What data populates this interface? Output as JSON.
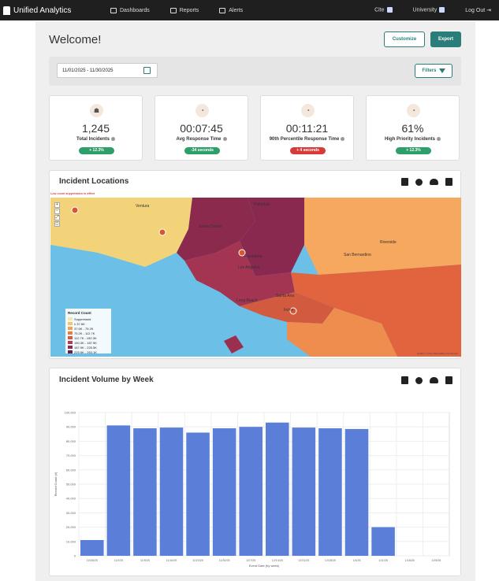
{
  "header": {
    "brand": "Unified Analytics",
    "nav": [
      "Dashboards",
      "Reports",
      "Alerts"
    ],
    "right": [
      "Cite",
      "University",
      "Log Out"
    ]
  },
  "page": {
    "title": "Welcome!",
    "customize_label": "Customize",
    "export_label": "Export",
    "date_range": "11/01/2025 - 11/30/2025",
    "filters_label": "Filters"
  },
  "kpis": [
    {
      "icon": "incidents-icon",
      "value": "1,245",
      "label": "Total Incidents",
      "badge": "+ 12.3%",
      "badge_color": "#2e9e6a"
    },
    {
      "icon": "stopwatch-icon",
      "value": "00:07:45",
      "label": "Avg Response Time",
      "badge": "-34 seconds",
      "badge_color": "#2e9e6a"
    },
    {
      "icon": "stopwatch-icon",
      "value": "00:11:21",
      "label": "90th Percentile Response Time",
      "badge": "+ 4 seconds",
      "badge_color": "#d83a3a"
    },
    {
      "icon": "stopwatch-icon",
      "value": "61%",
      "label": "High Priority Incidents",
      "badge": "+ 12.3%",
      "badge_color": "#2e9e6a"
    }
  ],
  "map_panel": {
    "title": "Incident Locations",
    "note": "Low count suppression in effect",
    "legend_title": "Record Count",
    "legend": [
      {
        "label": "Suppressed",
        "color": "#f6e7a6"
      },
      {
        "label": "≤ 37.6K",
        "color": "#f7c36f"
      },
      {
        "label": "37.6K - 75.2K",
        "color": "#f4a14f"
      },
      {
        "label": "75.2K - 112.7K",
        "color": "#ec7a43"
      },
      {
        "label": "112.7K - 150.3K",
        "color": "#dd5840"
      },
      {
        "label": "150.3K - 187.9K",
        "color": "#b7374f"
      },
      {
        "label": "187.9K - 225.5K",
        "color": "#8f2a4f"
      },
      {
        "label": "225.5K - 263.1K",
        "color": "#6a1f47"
      }
    ],
    "places": [
      "Ventura",
      "Santa Clarita",
      "Palmdale",
      "Pasadena",
      "Los Angeles",
      "Long Beach",
      "Santa Ana",
      "Riverside",
      "San Bernardino",
      "Irvine"
    ],
    "attribution": "Leaflet | © OpenStreetMap contributors"
  },
  "volume_panel": {
    "title": "Incident Volume by Week"
  },
  "chart_data": {
    "type": "bar",
    "categories": [
      "10/26/25",
      "11/2/25",
      "11/9/25",
      "11/16/25",
      "11/23/25",
      "11/30/25",
      "12/7/25",
      "12/14/25",
      "12/21/25",
      "12/28/25",
      "1/4/26",
      "1/11/26",
      "1/18/26",
      "1/25/26"
    ],
    "values": [
      11000,
      91000,
      89000,
      89500,
      86000,
      89000,
      90000,
      93000,
      89500,
      89000,
      88500,
      20000,
      0,
      0
    ],
    "ylim": [
      0,
      100000
    ],
    "yticks": [
      "0",
      "10,000",
      "20,000",
      "30,000",
      "40,000",
      "50,000",
      "60,000",
      "70,000",
      "80,000",
      "90,000",
      "100,000"
    ],
    "ylabel": "Record Count (#)",
    "xlabel": "Event Date (by week)",
    "bar_color": "#5b7fd9"
  }
}
